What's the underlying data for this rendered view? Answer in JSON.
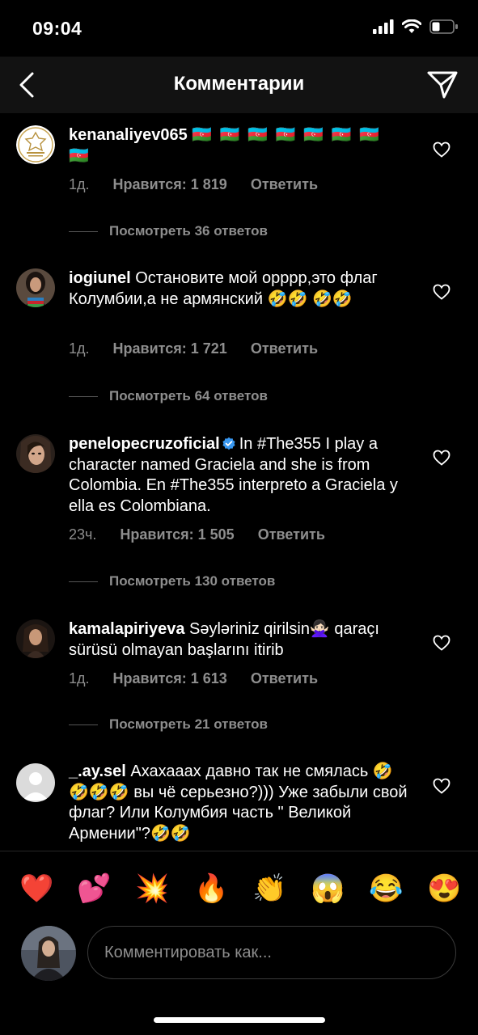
{
  "status": {
    "time": "09:04"
  },
  "header": {
    "title": "Комментарии"
  },
  "comments": [
    {
      "username": "kenanaliyev065",
      "text": "",
      "flags": "🇦🇿 🇦🇿 🇦🇿 🇦🇿 🇦🇿 🇦🇿 🇦🇿",
      "flags2": "🇦🇿",
      "time": "1д.",
      "likes": "Нравится: 1 819",
      "reply": "Ответить",
      "view_replies": "Посмотреть 36 ответов"
    },
    {
      "username": "iogiunel",
      "text": "Остановите мой орррр,это флаг Колумбии,а не армянский 🤣🤣 🤣🤣",
      "time": "1д.",
      "likes": "Нравится: 1 721",
      "reply": "Ответить",
      "view_replies": "Посмотреть 64 ответов"
    },
    {
      "username": "penelopecruzoficial",
      "text": "In #The355 I play a character named Graciela and she is from Colombia. En #The355 interpreto a Graciela y ella es Colombiana.",
      "time": "23ч.",
      "likes": "Нравится: 1 505",
      "reply": "Ответить",
      "view_replies": "Посмотреть 130 ответов"
    },
    {
      "username": "kamalapiriyeva",
      "text": "Səyləriniz qirilsin🙅🏻‍♀️ qaraçı sürüsü olmayan başlarını itirib",
      "time": "1д.",
      "likes": "Нравится: 1 613",
      "reply": "Ответить",
      "view_replies": "Посмотреть 21 ответов"
    },
    {
      "username": "_.ay.sel",
      "text": "Ахахааах давно так не смялась 🤣🤣🤣🤣 вы чё серьезно?))) Уже забыли свой флаг? Или Колумбия часть \" Великой Армении\"?🤣🤣"
    }
  ],
  "emoji_bar": [
    "❤️",
    "💕",
    "💥",
    "🔥",
    "👏",
    "😱",
    "😂",
    "😍"
  ],
  "composer": {
    "placeholder": "Комментировать как..."
  },
  "colors": {
    "background": "#000000",
    "header": "#121212",
    "muted": "#8e8e8e",
    "verified": "#3897f0"
  }
}
